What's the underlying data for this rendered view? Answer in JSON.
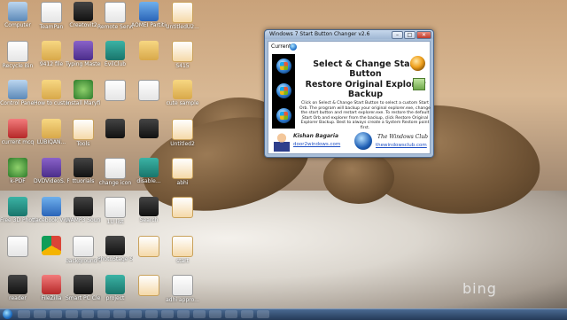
{
  "desktop": {
    "watermark": "bing",
    "icons": [
      {
        "label": "Computer",
        "type": "comp"
      },
      {
        "label": "Recycle Bin",
        "type": "doc"
      },
      {
        "label": "Control Panel",
        "type": "comp"
      },
      {
        "label": "current mcq",
        "type": "red"
      },
      {
        "label": "k-PDF",
        "type": "green"
      },
      {
        "label": "Free 3D Photo Maker",
        "type": "teal"
      },
      {
        "label": "",
        "type": "doc"
      },
      {
        "label": "reader",
        "type": "dark"
      },
      {
        "label": "TeamPan",
        "type": "doc"
      },
      {
        "label": "9412 file",
        "type": "folder"
      },
      {
        "label": "How to customiz...",
        "type": "folder"
      },
      {
        "label": "LUBIQAN...",
        "type": "folder"
      },
      {
        "label": "DVDVideoS. Free Studio",
        "type": "purple"
      },
      {
        "label": "facebook Video...",
        "type": "blue"
      },
      {
        "label": "",
        "type": "chrome"
      },
      {
        "label": "FileZilla",
        "type": "red"
      },
      {
        "label": "Creatovit2",
        "type": "dark"
      },
      {
        "label": "Typing Master Pro",
        "type": "purple"
      },
      {
        "label": "Install Maryfi",
        "type": "green"
      },
      {
        "label": "Tools",
        "type": "pdf"
      },
      {
        "label": "ttuorials",
        "type": "dark"
      },
      {
        "label": "WAMP3 Sound Editor",
        "type": "dark"
      },
      {
        "label": "background images",
        "type": "doc"
      },
      {
        "label": "Smart PC Cleaner",
        "type": "dark"
      },
      {
        "label": "Remote Server",
        "type": "doc"
      },
      {
        "label": "EvilClub",
        "type": "teal"
      },
      {
        "label": "",
        "type": "doc"
      },
      {
        "label": "",
        "type": "dark"
      },
      {
        "label": "change icon",
        "type": "doc"
      },
      {
        "label": "1U list",
        "type": "doc"
      },
      {
        "label": "PhotoStage Slideshow",
        "type": "dark"
      },
      {
        "label": "project",
        "type": "teal"
      },
      {
        "label": "AOMEI Partition A...",
        "type": "blue"
      },
      {
        "label": "",
        "type": "folder"
      },
      {
        "label": "",
        "type": "doc"
      },
      {
        "label": "",
        "type": "dark"
      },
      {
        "label": "disable...",
        "type": "teal"
      },
      {
        "label": "Search",
        "type": "dark"
      },
      {
        "label": "",
        "type": "pdf"
      },
      {
        "label": "",
        "type": "pdf"
      },
      {
        "label": "UntitledU2...",
        "type": "pdf"
      },
      {
        "label": "S415",
        "type": "pdf"
      },
      {
        "label": "cute sample",
        "type": "folder"
      },
      {
        "label": "Untitled2",
        "type": "pdf"
      },
      {
        "label": "abhi",
        "type": "pdf"
      },
      {
        "label": "",
        "type": "pdf"
      },
      {
        "label": "start",
        "type": "pdf"
      },
      {
        "label": "adhi appro...",
        "type": "doc"
      }
    ]
  },
  "window": {
    "title": "Windows 7 Start Button Changer v2.6",
    "controls": {
      "minimize": "–",
      "maximize": "□",
      "close": "✕"
    },
    "current_label": "Current",
    "select_label": "Select & Change Start Button",
    "restore_label": "Restore Original Explorer Backup",
    "description": "Click on Select & Change Start Button to select a custom Start Orb. The program will backup your original explorer.exe, change the start button and restart explorer.exe. To restore the default Start Orb and explorer from the backup, click Restore Original Explorer Backup. Best to always create a System Restore point first.",
    "author_name": "Kishan Bagaria",
    "author_link": "door2windows.com",
    "club_name": "The Windows Club",
    "club_link": "thewindowsclub.com"
  },
  "taskbar": {
    "start_orb": "start-orb",
    "buttons": [
      "ie-icon",
      "explorer-icon",
      "media-icon",
      "chrome-icon",
      "word-icon",
      "folder-icon",
      "app-icon",
      "app-icon",
      "app-icon",
      "app-icon",
      "app-icon",
      "app-icon",
      "app-icon",
      "app-icon",
      "app-icon",
      "app-icon"
    ]
  }
}
